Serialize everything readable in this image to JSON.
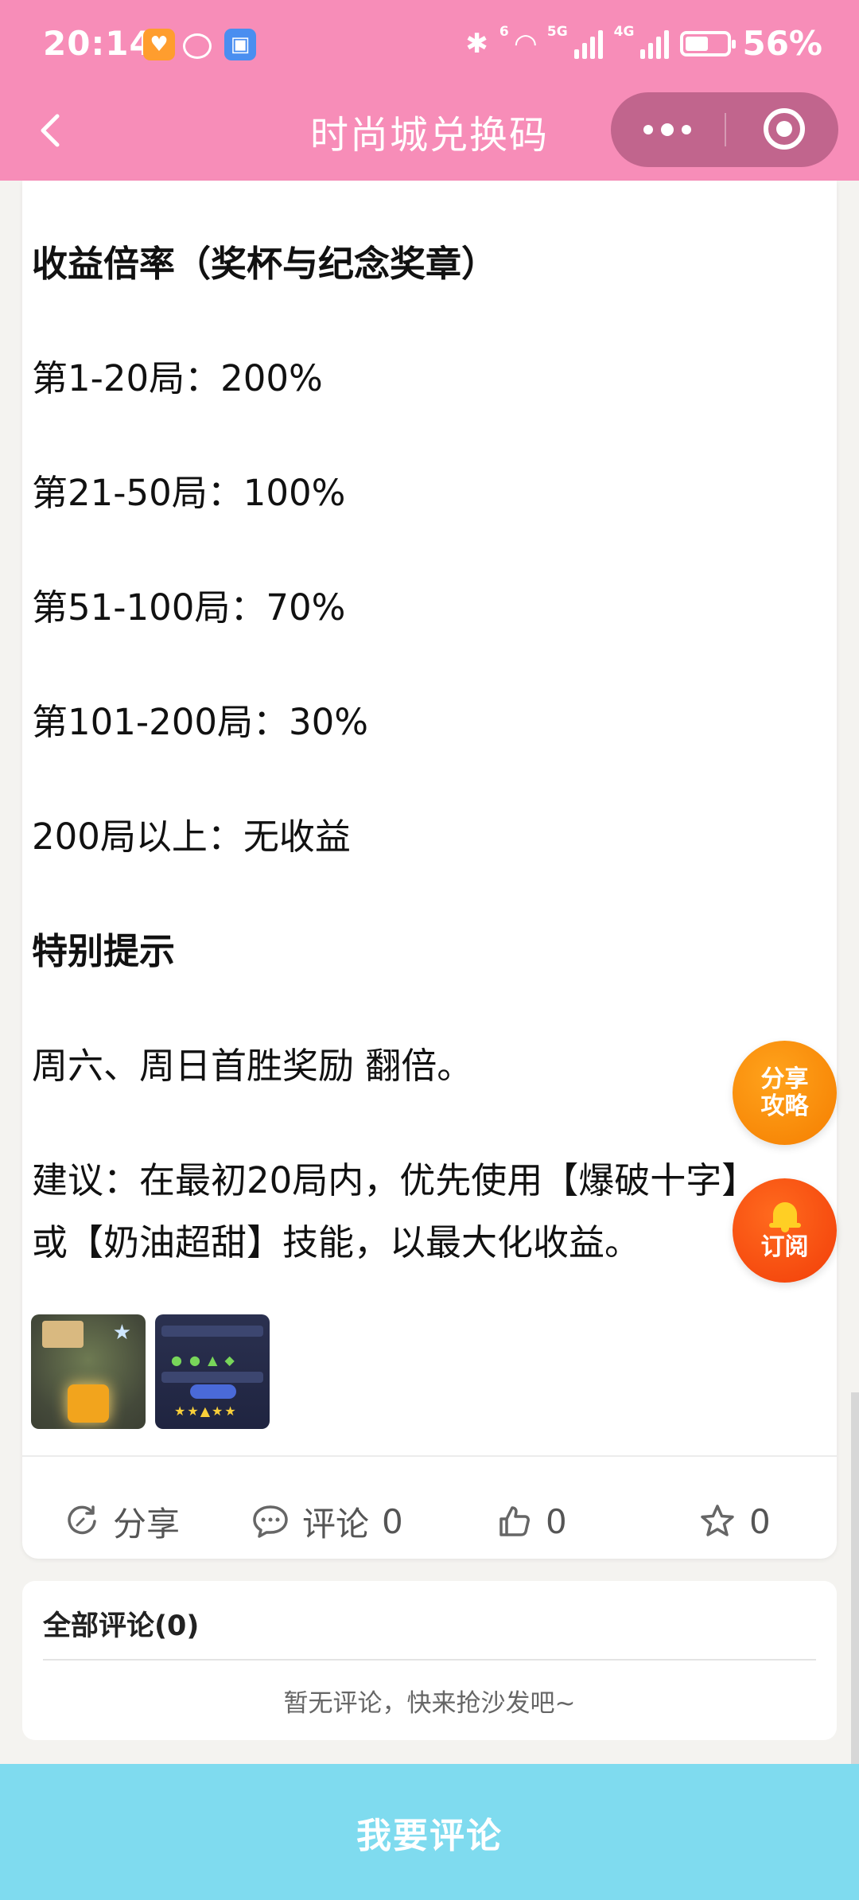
{
  "status_bar": {
    "time": "20:14",
    "network_5g": "5G",
    "network_4g": "4G",
    "wifi_tag": "6",
    "battery_percent": "56%",
    "battery_level": 0.56,
    "icons": [
      "app-orange-icon",
      "chat-bubble-icon",
      "app-blue-icon",
      "bluetooth-icon",
      "wifi-icon",
      "signal-icon",
      "battery-icon"
    ]
  },
  "nav": {
    "title": "时尚城兑换码",
    "back_icon": "chevron-left-icon",
    "more_icon": "more-dots-icon",
    "close_icon": "target-circle-icon"
  },
  "article": {
    "lines": [
      {
        "text": "收益倍率（奖杯与纪念奖章）",
        "bold": true
      },
      {
        "text": "第1-20局：200%",
        "bold": false
      },
      {
        "text": "第21-50局：100%",
        "bold": false
      },
      {
        "text": "第51-100局：70%",
        "bold": false
      },
      {
        "text": "第101-200局：30%",
        "bold": false
      },
      {
        "text": "200局以上：无收益",
        "bold": false
      },
      {
        "text": "特别提示",
        "bold": true
      },
      {
        "text": "周六、周日首胜奖励 翻倍。",
        "bold": false
      },
      {
        "text": "建议：在最初20局内，优先使用【爆破十字】",
        "bold": false
      },
      {
        "text": "或【奶油超甜】技能，以最大化收益。",
        "bold": false
      }
    ],
    "thumbnails": [
      "game-screenshot-1",
      "game-screenshot-2"
    ]
  },
  "actions": {
    "share_label": "分享",
    "comment_label": "评论",
    "comment_count": "0",
    "like_count": "0",
    "favorite_count": "0"
  },
  "comments": {
    "title": "全部评论(0)",
    "empty_text": "暂无评论，快来抢沙发吧~"
  },
  "floating": {
    "share_line1": "分享",
    "share_line2": "攻略",
    "subscribe_label": "订阅"
  },
  "bottom_button": {
    "label": "我要评论"
  },
  "colors": {
    "header_pink": "#f78db8",
    "fab_orange": "#f57e00",
    "fab_red": "#f23e09",
    "bottom_cyan": "#7fdbef"
  }
}
